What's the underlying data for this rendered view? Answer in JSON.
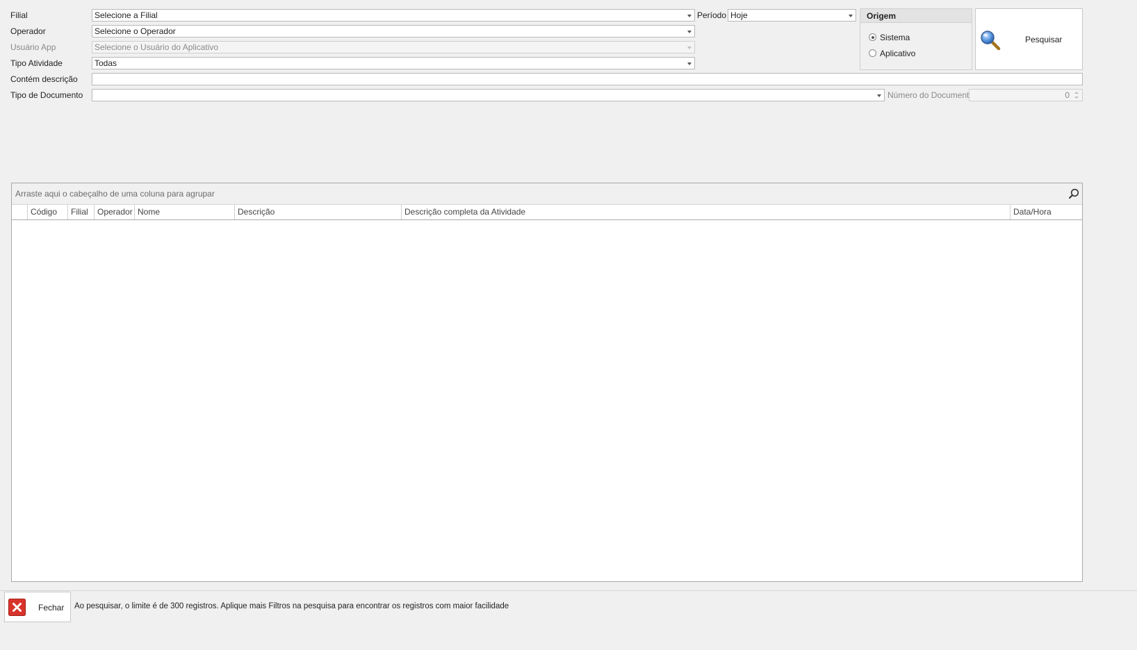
{
  "filters": {
    "filial": {
      "label": "Filial",
      "value": "Selecione a Filial"
    },
    "operador": {
      "label": "Operador",
      "value": "Selecione o Operador"
    },
    "usuario_app": {
      "label": "Usuário App",
      "value": "Selecione o Usuário do Aplicativo"
    },
    "tipo_atividade": {
      "label": "Tipo Atividade",
      "value": "Todas"
    },
    "contem_descricao": {
      "label": "Contém descrição",
      "value": ""
    },
    "tipo_documento": {
      "label": "Tipo de Documento",
      "value": ""
    },
    "periodo": {
      "label": "Período",
      "value": "Hoje"
    },
    "numero_documento": {
      "label": "Número do Documento",
      "value": "0"
    }
  },
  "origem": {
    "title": "Origem",
    "options": [
      "Sistema",
      "Aplicativo"
    ],
    "selected": "Sistema"
  },
  "search_button": {
    "label": "Pesquisar",
    "icon": "magnifier-icon"
  },
  "grid": {
    "group_panel_text": "Arraste aqui o cabeçalho de uma coluna para agrupar",
    "columns": [
      "Código",
      "Filial",
      "Operador",
      "Nome",
      "Descrição",
      "Descrição completa da Atividade",
      "Data/Hora"
    ],
    "rows": []
  },
  "footer": {
    "close_label": "Fechar",
    "message": "Ao pesquisar, o limite é de 300 registros. Aplique mais Filtros na pesquisa para encontrar os registros com maior facilidade"
  },
  "colors": {
    "close_red": "#d9342b",
    "magnifier_blue": "#2f6fc9"
  }
}
